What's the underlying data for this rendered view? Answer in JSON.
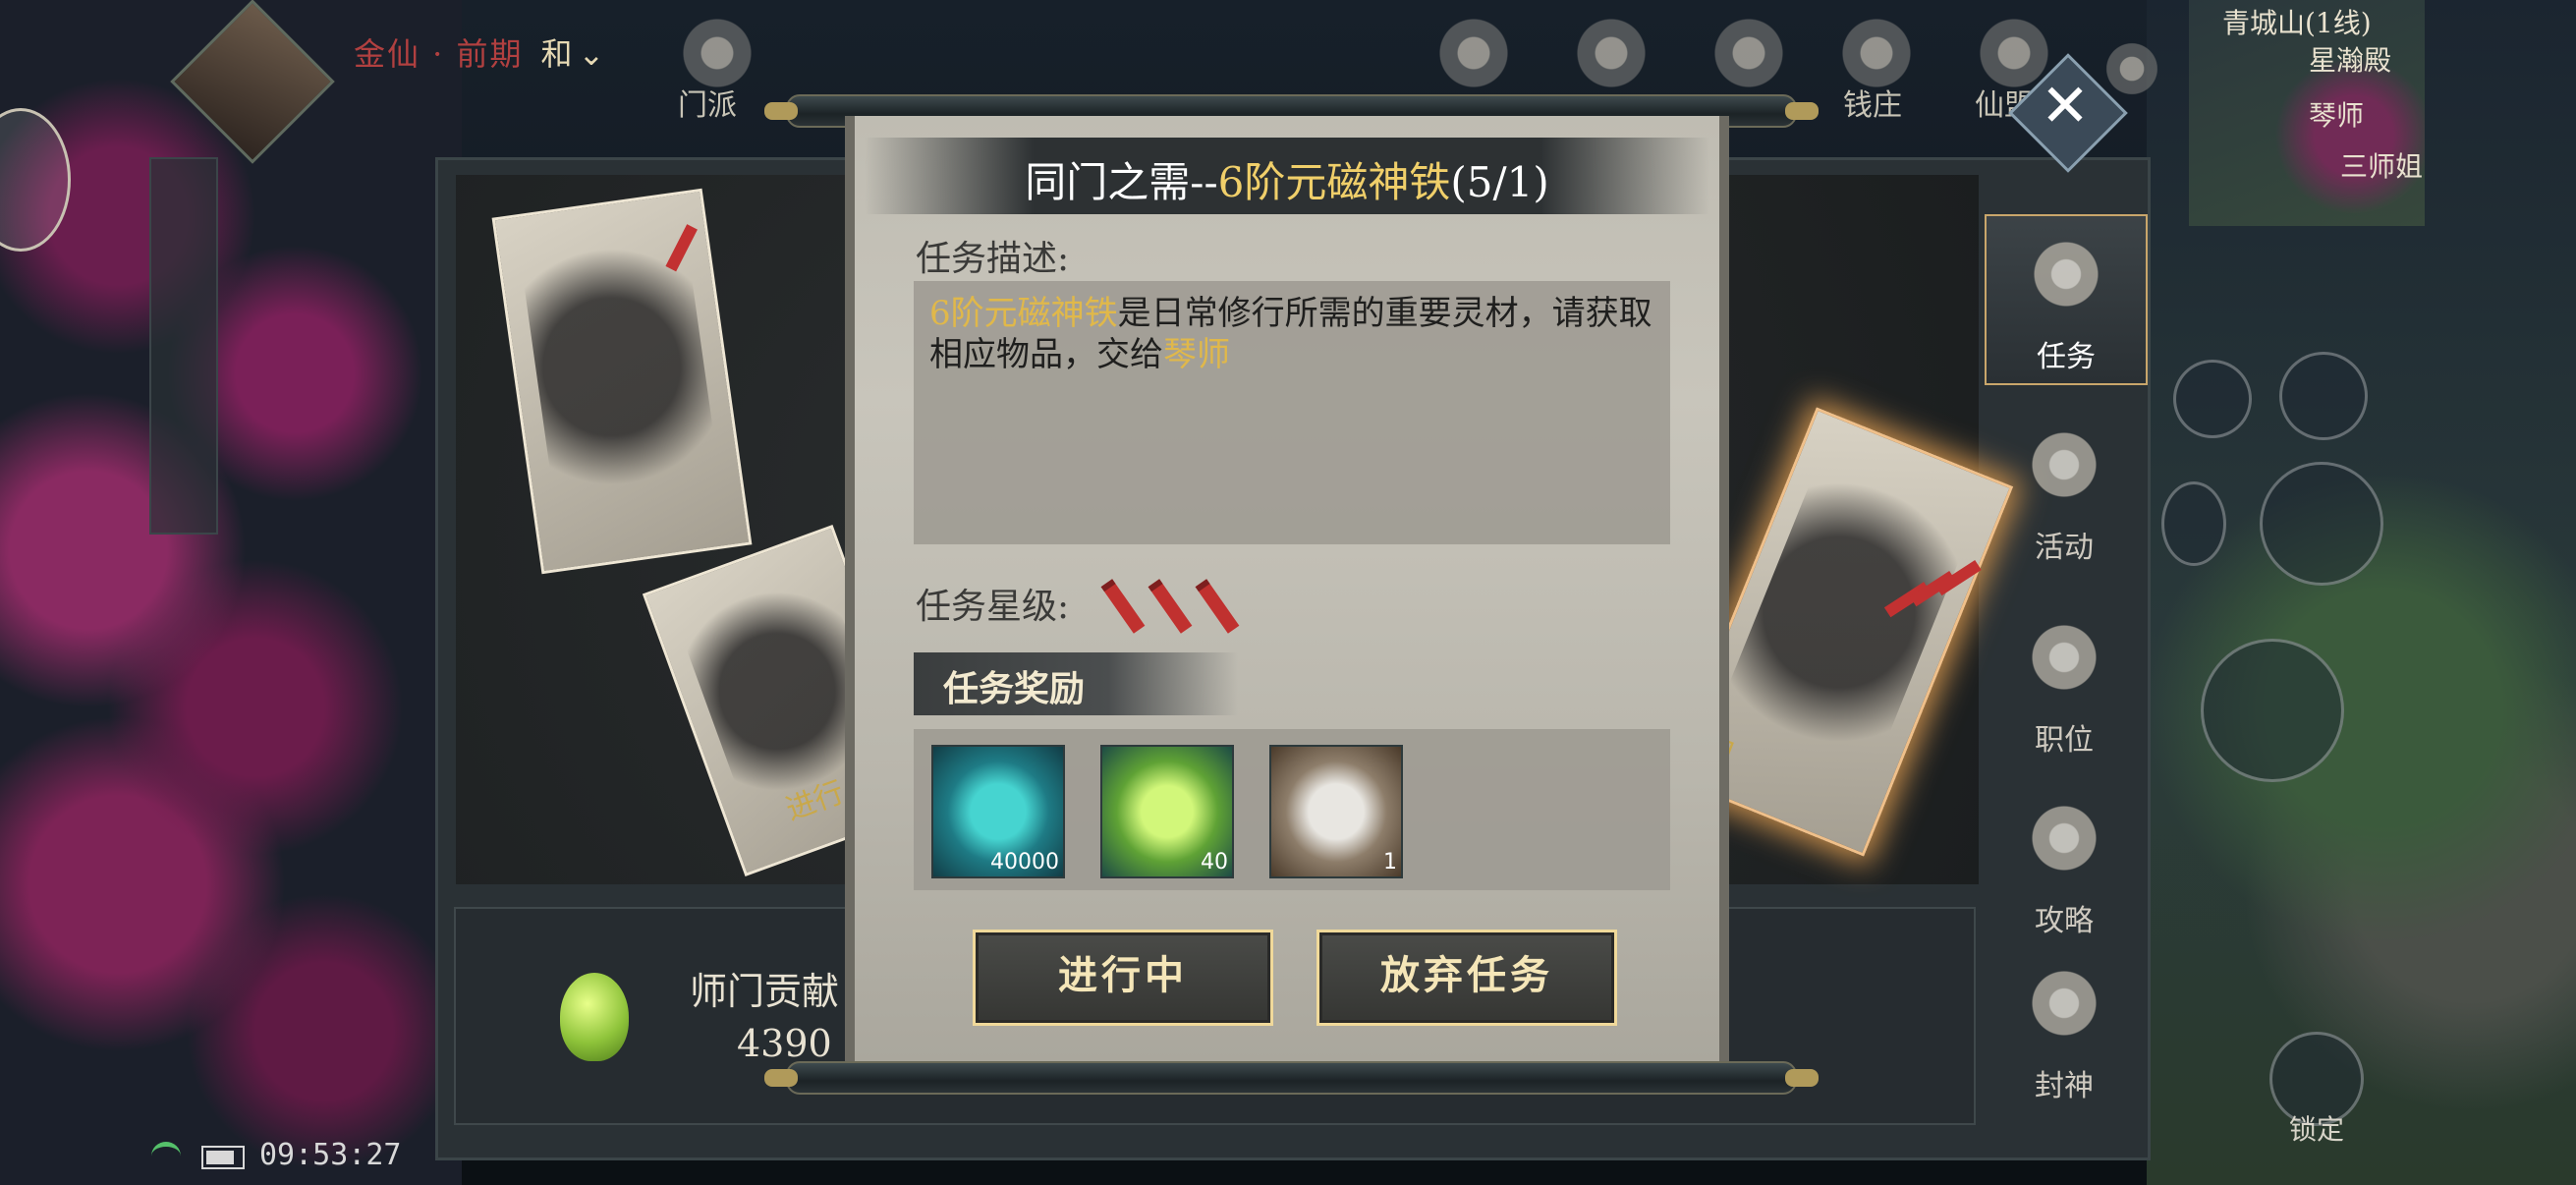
{
  "hud": {
    "realm": "金仙 · 前期",
    "peace_mode": "和",
    "top_labels": [
      "门派",
      "钱庄",
      "仙盟"
    ],
    "map": {
      "location": "青城山(1线)",
      "place": "星瀚殿",
      "npc1": "琴师",
      "npc2": "三师姐"
    },
    "lock_label": "锁定"
  },
  "status_bar": {
    "time": "09:53:27"
  },
  "side_tabs": [
    {
      "label": "任务",
      "icon": "scroll-quest-icon",
      "selected": true
    },
    {
      "label": "活动",
      "icon": "activity-icon",
      "selected": false
    },
    {
      "label": "职位",
      "icon": "position-icon",
      "selected": false
    },
    {
      "label": "攻略",
      "icon": "guide-cards-icon",
      "selected": false
    },
    {
      "label": "封神",
      "icon": "deify-icon",
      "selected": false
    }
  ],
  "contribution": {
    "label": "师门贡献",
    "value": "4390"
  },
  "board_stamps": {
    "left": "进行",
    "right": "中"
  },
  "dialog": {
    "title_prefix": "同门之需--",
    "title_item": "6阶元磁神铁",
    "title_count": "(5/1)",
    "desc_label": "任务描述:",
    "desc_item": "6阶元磁神铁",
    "desc_middle": "是日常修行所需的重要灵材，请获取相应物品，交给",
    "desc_npc": "琴师",
    "stars_label": "任务星级:",
    "stars": 3,
    "reward_header": "任务奖励",
    "rewards": [
      {
        "name": "crystal-item",
        "qty": "40000"
      },
      {
        "name": "contribution-gem-item",
        "qty": "40"
      },
      {
        "name": "equipment-chest-item",
        "qty": "1"
      }
    ],
    "btn_progress": "进行中",
    "btn_abandon": "放弃任务"
  },
  "colors": {
    "accent_gold": "#f0cf6a",
    "star_red": "#c0312f"
  }
}
